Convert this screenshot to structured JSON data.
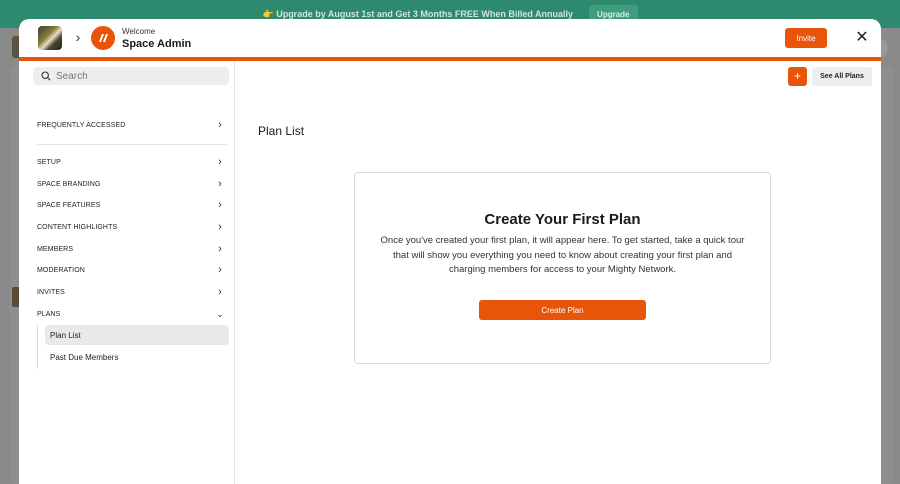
{
  "banner": {
    "text": "👉 Upgrade by August 1st and Get 3 Months FREE When Billed Annually",
    "button": "Upgrade"
  },
  "header": {
    "welcome": "Welcome",
    "space_name": "Space Admin",
    "invite": "Invite"
  },
  "sidebar": {
    "search_placeholder": "Search",
    "items": [
      {
        "label": "FREQUENTLY ACCESSED"
      },
      {
        "label": "SETUP"
      },
      {
        "label": "SPACE BRANDING"
      },
      {
        "label": "SPACE FEATURES"
      },
      {
        "label": "CONTENT HIGHLIGHTS"
      },
      {
        "label": "MEMBERS"
      },
      {
        "label": "MODERATION"
      },
      {
        "label": "INVITES"
      },
      {
        "label": "PLANS"
      }
    ],
    "plans_sub": [
      {
        "label": "Plan List"
      },
      {
        "label": "Past Due Members"
      }
    ]
  },
  "main": {
    "see_all": "See All Plans",
    "title": "Plan List",
    "empty_title": "Create Your First Plan",
    "empty_body": "Once you've created your first plan, it will appear here. To get started, take a quick tour that will show you everything you need to know about creating your first plan and charging members for access to your Mighty Network.",
    "create_button": "Create Plan"
  },
  "colors": {
    "accent": "#e8540a",
    "banner": "#2e8a6e"
  }
}
